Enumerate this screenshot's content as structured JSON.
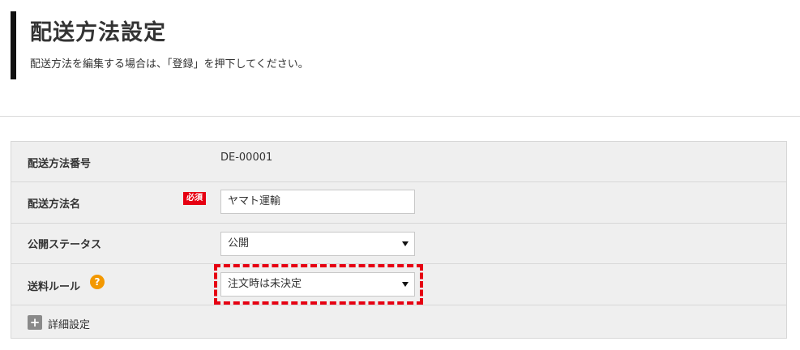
{
  "header": {
    "title": "配送方法設定",
    "description": "配送方法を編集する場合は、「登録」を押下してください。"
  },
  "form": {
    "id_row": {
      "label": "配送方法番号",
      "value": "DE-00001"
    },
    "name_row": {
      "label": "配送方法名",
      "required_badge": "必須",
      "value": "ヤマト運輸"
    },
    "status_row": {
      "label": "公開ステータス",
      "selected": "公開"
    },
    "shipping_rule_row": {
      "label": "送料ルール",
      "help_icon": "?",
      "selected": "注文時は未決定"
    },
    "detail_toggle": {
      "icon": "+",
      "label": "詳細設定"
    }
  },
  "colors": {
    "required": "#e60012",
    "help_icon": "#f39800",
    "highlight": "#e60012",
    "panel_bg": "#efefef"
  }
}
